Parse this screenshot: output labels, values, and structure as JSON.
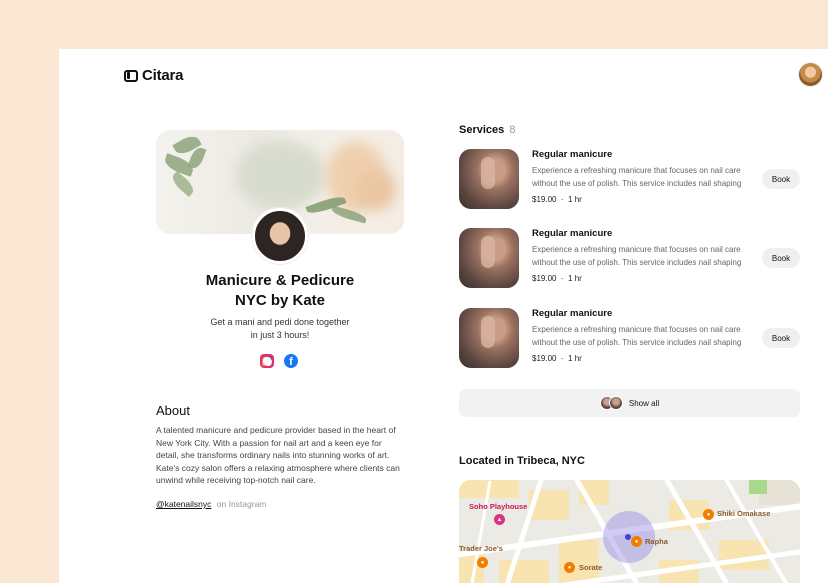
{
  "app": {
    "name": "Citara"
  },
  "profile": {
    "name_line1": "Manicure & Pedicure",
    "name_line2": "NYC by Kate",
    "tagline_line1": "Get a mani and pedi done together",
    "tagline_line2": "in just 3 hours!",
    "socials": [
      "instagram-icon",
      "facebook-icon"
    ]
  },
  "about": {
    "title": "About",
    "text": "A talented manicure and pedicure provider based in the heart of New York City. With a passion for nail art and a keen eye for detail, she transforms ordinary nails into stunning works of art. Kate's cozy salon offers a relaxing atmosphere where clients can unwind while receiving top-notch nail care.",
    "handle": "@katenailsnyc",
    "handle_suffix": "on Instagram"
  },
  "services": {
    "title": "Services",
    "count": "8",
    "items": [
      {
        "name": "Regular manicure",
        "description": "Experience a refreshing manicure that focuses on nail care without the use of polish. This service includes nail shaping",
        "price": "$19.00",
        "duration": "1 hr",
        "book_label": "Book"
      },
      {
        "name": "Regular manicure",
        "description": "Experience a refreshing manicure that focuses on nail care without the use of polish. This service includes nail shaping",
        "price": "$19.00",
        "duration": "1 hr",
        "book_label": "Book"
      },
      {
        "name": "Regular manicure",
        "description": "Experience a refreshing manicure that focuses on nail care without the use of polish. This service includes nail shaping",
        "price": "$19.00",
        "duration": "1 hr",
        "book_label": "Book"
      }
    ],
    "show_all_label": "Show all"
  },
  "location": {
    "title": "Located in Tribeca, NYC",
    "pois": {
      "soho": "Soho Playhouse",
      "shiki": "Shiki Omakase",
      "rapha": "Rapha",
      "trader": "Trader Joe's",
      "sorate": "Sorate"
    }
  },
  "colors": {
    "background": "#fbe8d4",
    "accent_purple": "#4a3ed8",
    "poi_pink": "#c2185b",
    "poi_orange": "#f57c00"
  }
}
